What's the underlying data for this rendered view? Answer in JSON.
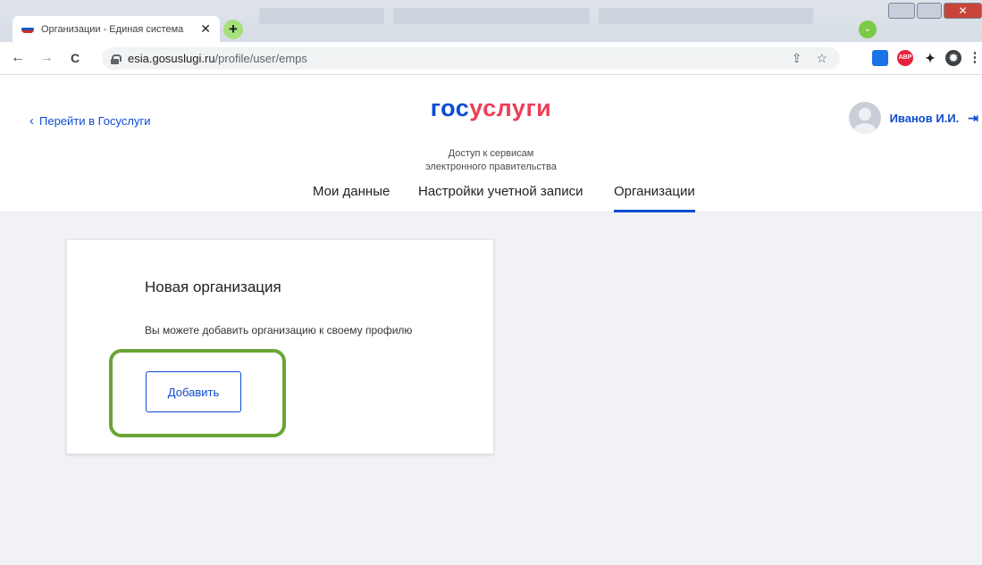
{
  "browser": {
    "tab_title": "Организации - Единая система",
    "tab_close": "✕",
    "new_tab": "+",
    "tab_menu": "⌄",
    "window_close": "✕",
    "url_host": "esia.gosuslugi.ru",
    "url_path": "/profile/user/emps",
    "nav": {
      "back": "←",
      "forward": "→",
      "reload": "C"
    },
    "omni_icons": {
      "share": "⇪",
      "star": "☆"
    },
    "extensions": [
      {
        "name": "pocket-extension-icon",
        "label": "",
        "color": "#1a73e8"
      },
      {
        "name": "adblock-extension-icon",
        "label": "ABP",
        "color": "#e8213c"
      },
      {
        "name": "puzzle-extension-icon",
        "label": "✦",
        "color": "#202124"
      },
      {
        "name": "settings-extension-icon",
        "label": "✹",
        "color": "#3c4043"
      }
    ],
    "menu_icon": "⋮"
  },
  "header": {
    "back_link": "Перейти в Госуслуги",
    "logo_part1": "гос",
    "logo_part2": "услуги",
    "subtitle_line1": "Доступ к сервисам",
    "subtitle_line2": "электронного правительства",
    "user_name": "Иванов И.И.",
    "logout_icon": "⇥"
  },
  "tabs": {
    "my_data": "Мои данные",
    "account_settings": "Настройки учетной записи",
    "organizations": "Организации"
  },
  "card": {
    "title": "Новая организация",
    "text": "Вы можете добавить организацию к своему профилю",
    "add_button": "Добавить"
  },
  "colors": {
    "brand_blue": "#0d4cd3",
    "brand_red": "#ee3f58",
    "highlight_green": "#6aa534",
    "page_background": "#f0f2f5"
  }
}
